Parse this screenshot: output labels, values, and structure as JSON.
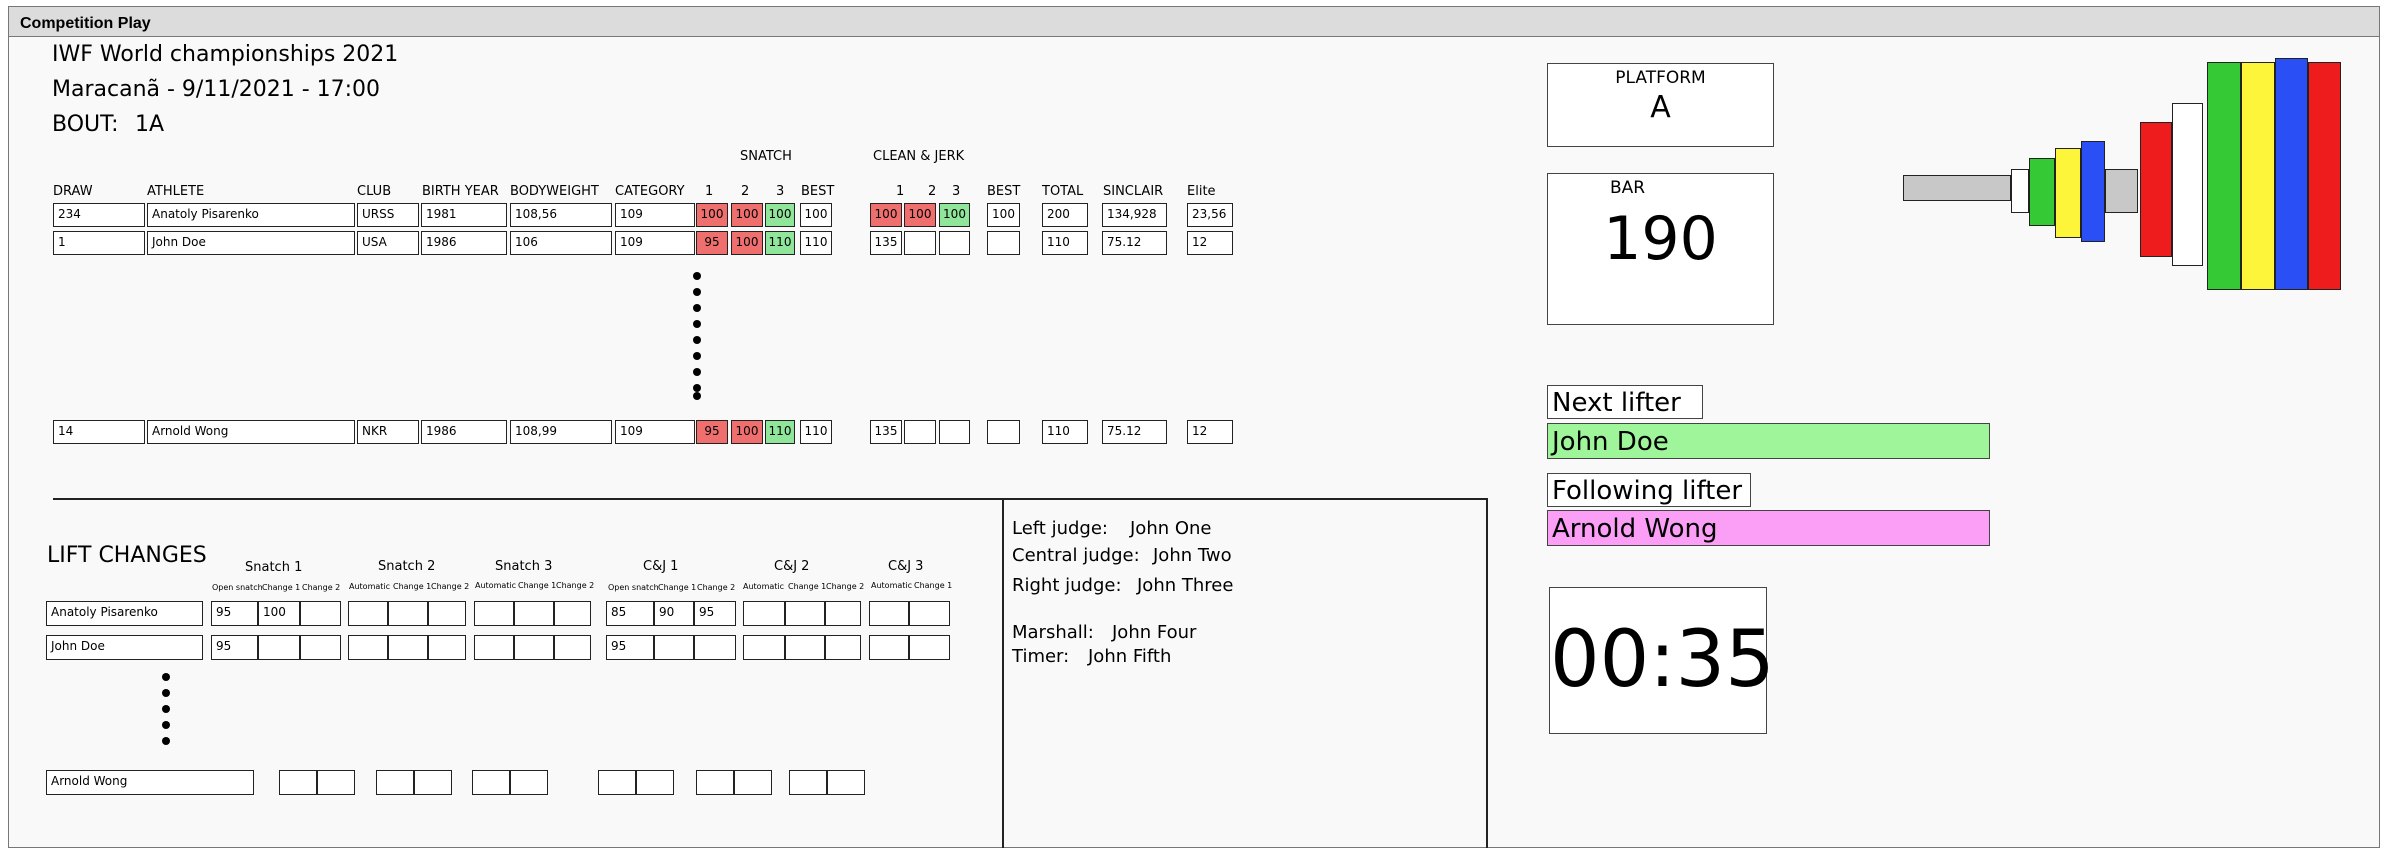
{
  "window": {
    "title": "Competition Play"
  },
  "event": {
    "title": "IWF World championships 2021",
    "venue_line": "Maracanã - 9/11/2021 - 17:00",
    "bout_label": "BOUT:",
    "bout_value": "1A"
  },
  "table": {
    "group_snatch": "SNATCH",
    "group_cj": "CLEAN & JERK",
    "headers": {
      "draw": "DRAW",
      "athlete": "ATHLETE",
      "club": "CLUB",
      "birth_year": "BIRTH YEAR",
      "bodyweight": "BODYWEIGHT",
      "category": "CATEGORY",
      "s1": "1",
      "s2": "2",
      "s3": "3",
      "s_best": "BEST",
      "cj1": "1",
      "cj2": "2",
      "cj3": "3",
      "cj_best": "BEST",
      "total": "TOTAL",
      "sinclair": "SINCLAIR",
      "elite": "Elite"
    },
    "rows": [
      {
        "draw": "234",
        "athlete": "Anatoly Pisarenko",
        "club": "URSS",
        "birth_year": "1981",
        "bodyweight": "108,56",
        "category": "109",
        "s1": "100",
        "s2": "100",
        "s3": "100",
        "s_best": "100",
        "cj1": "100",
        "cj2": "100",
        "cj3": "100",
        "cj_best": "100",
        "total": "200",
        "sinclair": "134,928",
        "elite": "23,56"
      },
      {
        "draw": "1",
        "athlete": "John Doe",
        "club": "USA",
        "birth_year": "1986",
        "bodyweight": "106",
        "category": "109",
        "s1": "95",
        "s2": "100",
        "s3": "110",
        "s_best": "110",
        "cj1": "135",
        "cj2": "",
        "cj3": "",
        "cj_best": "",
        "total": "110",
        "sinclair": "75.12",
        "elite": "12"
      },
      {
        "draw": "14",
        "athlete": "Arnold Wong",
        "club": "NKR",
        "birth_year": "1986",
        "bodyweight": "108,99",
        "category": "109",
        "s1": "95",
        "s2": "100",
        "s3": "110",
        "s_best": "110",
        "cj1": "135",
        "cj2": "",
        "cj3": "",
        "cj_best": "",
        "total": "110",
        "sinclair": "75.12",
        "elite": "12"
      }
    ]
  },
  "lift_changes": {
    "title": "LIFT CHANGES",
    "groups": {
      "snatch1": {
        "title": "Snatch 1",
        "subs": [
          "Open snatch",
          "Change 1",
          "Change 2"
        ]
      },
      "snatch2": {
        "title": "Snatch 2",
        "subs": [
          "Automatic",
          "Change 1",
          "Change 2"
        ]
      },
      "snatch3": {
        "title": "Snatch 3",
        "subs": [
          "Automatic",
          "Change 1",
          "Change 2"
        ]
      },
      "cj1": {
        "title": "C&J 1",
        "subs": [
          "Open snatch",
          "Change 1",
          "Change 2"
        ]
      },
      "cj2": {
        "title": "C&J 2",
        "subs": [
          "Automatic",
          "Change 1",
          "Change 2"
        ]
      },
      "cj3": {
        "title": "C&J 3",
        "subs": [
          "Automatic",
          "Change 1"
        ]
      }
    },
    "rows": [
      {
        "athlete": "Anatoly Pisarenko",
        "s1_open": "95",
        "s1_c1": "100",
        "cj1_open": "85",
        "cj1_c1": "90",
        "cj1_c2": "95"
      },
      {
        "athlete": "John Doe",
        "s1_open": "95",
        "cj1_open": "95"
      },
      {
        "athlete": "Arnold Wong"
      }
    ]
  },
  "officials": {
    "left_judge_label": "Left judge:",
    "left_judge": "John One",
    "central_judge_label": "Central judge:",
    "central_judge": "John Two",
    "right_judge_label": "Right judge:",
    "right_judge": "John Three",
    "marshall_label": "Marshall:",
    "marshall": "John Four",
    "timer_label": "Timer:",
    "timer": "John Fifth"
  },
  "platform": {
    "label": "PLATFORM",
    "value": "A"
  },
  "bar": {
    "label": "BAR",
    "value": "190"
  },
  "next_lifter": {
    "label": "Next lifter",
    "name": "John Doe"
  },
  "following_lifter": {
    "label": "Following lifter",
    "name": "Arnold Wong"
  },
  "clock": {
    "value": "00:35"
  },
  "colors": {
    "good_lift": "#8fe69a",
    "no_lift": "#ef6f6f",
    "next_bg": "#9ff59a",
    "following_bg": "#fb9ef5",
    "plate_red": "#ee1c1c",
    "plate_green": "#35c935",
    "plate_yellow": "#fcf53a",
    "plate_blue": "#2a4ff5",
    "plate_white": "#ffffff",
    "bar_grey": "#c8c8c8"
  }
}
